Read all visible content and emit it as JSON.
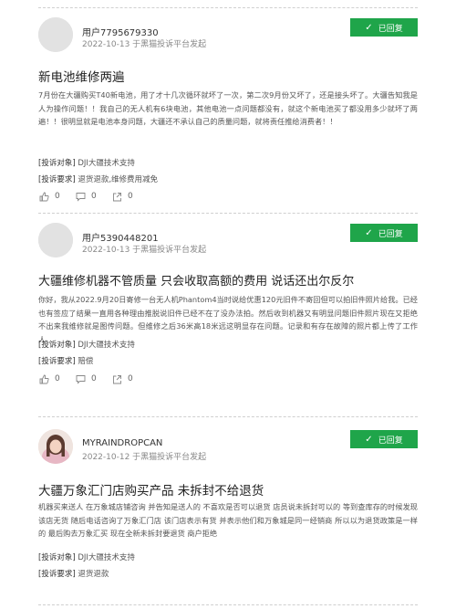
{
  "posts": [
    {
      "user": "用户7795679330",
      "meta": "2022-10-13 于黑猫投诉平台发起",
      "status": "已回复",
      "title": "新电池维修两遍",
      "body": "7月份在大疆购买T40新电池，用了才十几次循环就坏了一次，第二次9月份又坏了，还是接头坏了。大疆告知我是人为操作问题！！我自己的无人机有6块电池，其他电池一点问题都没有，就这个新电池买了都没用多少就坏了两遍！！很明显就是电池本身问题，大疆还不承认自己的质量问题，就将责任推给消费者！！",
      "object_label": "[投诉对象]",
      "object_value": "DJI大疆技术支持",
      "request_label": "[投诉要求]",
      "request_value": "退货退款,维修费用减免",
      "likes": "0",
      "comments": "0",
      "shares": "0"
    },
    {
      "user": "用户5390448201",
      "meta": "2022-10-13 于黑猫投诉平台发起",
      "status": "已回复",
      "title": "大疆维修机器不管质量 只会收取高额的费用 说话还出尔反尔",
      "body": "你好，我从2022.9月20日寄修一台无人机Phantom4当时说给优惠120元旧件不寄回但可以拍旧件照片给我。已经也有签应了结果一直用各种理由推脱说旧件已经不在了没办法拍。然后收到机器又有明显问题旧件照片现在又拒绝不出来我维修就是图传问题。但维修之后36米高18米远这明显存在问题。记录和有存在故障的照片都上传了工作人...",
      "object_label": "[投诉对象]",
      "object_value": "DJI大疆技术支持",
      "request_label": "[投诉要求]",
      "request_value": "赔偿",
      "likes": "0",
      "comments": "0",
      "shares": "0"
    },
    {
      "user": "MYRAINDROPCAN",
      "meta": "2022-10-12 于黑猫投诉平台发起",
      "status": "已回复",
      "title": "大疆万象汇门店购买产品 未拆封不给退货",
      "body": "机器买来送人 在万象城店铺咨询 并告知是送人的 不喜欢是否可以退货 店员说未拆封可以的 等到查库存的时候发现 该店无货 随后电话咨询了万象汇门店 该门店表示有货 并表示他们和万象城是同一经销商 所以以为退货政策是一样的 最后购去万象汇买 现在全新未拆封要退货 商户拒绝",
      "object_label": "[投诉对象]",
      "object_value": "DJI大疆技术支持",
      "request_label": "[投诉要求]",
      "request_value": "退货退款"
    }
  ],
  "icons": {
    "status_check": "check-icon",
    "like": "thumbs-up-icon",
    "comment": "comment-icon",
    "share": "share-icon"
  },
  "colors": {
    "status_badge": "#1fa54a",
    "avatar_placeholder": "#dcdcdc"
  }
}
